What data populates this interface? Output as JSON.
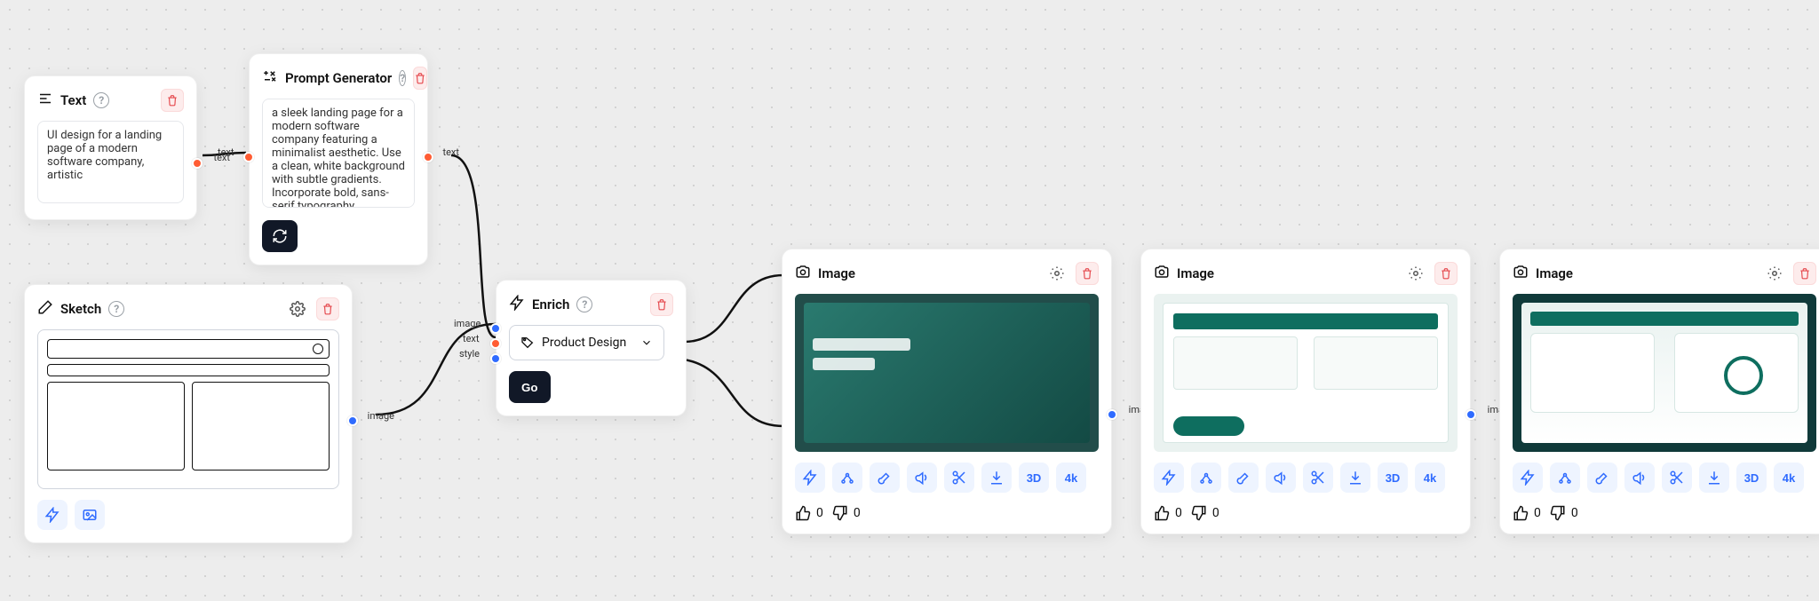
{
  "text_node": {
    "title": "Text",
    "value": "UI design for a landing page of a modern software company, artistic",
    "out_label": "text"
  },
  "prompt_node": {
    "title": "Prompt Generator",
    "value": "a sleek landing page for a modern software company featuring a minimalist aesthetic. Use a clean, white background with subtle gradients. Incorporate bold, sans-serif typography",
    "in_label": "text",
    "out_label": "text"
  },
  "sketch_node": {
    "title": "Sketch",
    "out_label": "image"
  },
  "enrich_node": {
    "title": "Enrich",
    "style_selected": "Product Design",
    "go_label": "Go",
    "in_labels": [
      "image",
      "text",
      "style"
    ]
  },
  "image_nodes": {
    "title": "Image",
    "out_label": "image",
    "vote_up": "0",
    "vote_down": "0",
    "badge_3d": "3D",
    "badge_4k": "4k"
  }
}
